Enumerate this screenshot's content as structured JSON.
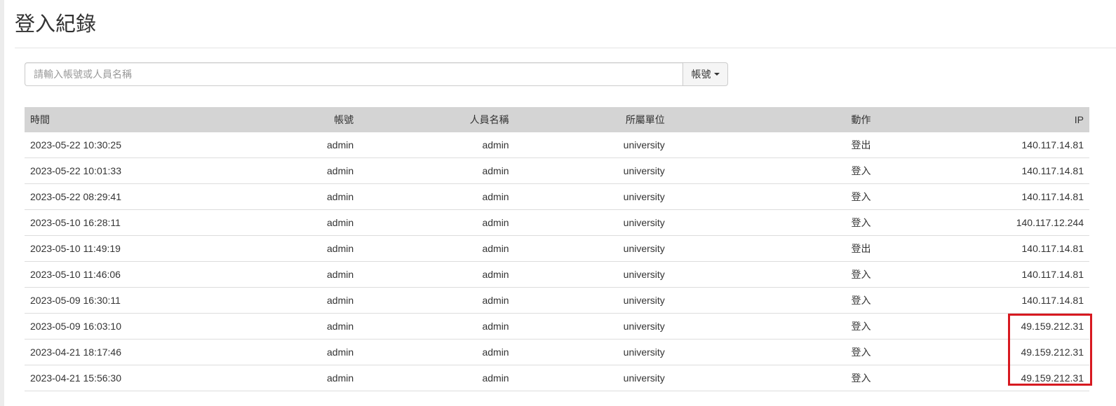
{
  "page": {
    "title": "登入紀錄"
  },
  "search": {
    "placeholder": "請輸入帳號或人員名稱",
    "field_selected": "帳號"
  },
  "table": {
    "headers": {
      "time": "時間",
      "account": "帳號",
      "name": "人員名稱",
      "unit": "所屬單位",
      "action": "動作",
      "ip": "IP"
    },
    "rows": [
      {
        "time": "2023-05-22 10:30:25",
        "account": "admin",
        "name": "admin",
        "unit": "university",
        "action": "登出",
        "ip": "140.117.14.81"
      },
      {
        "time": "2023-05-22 10:01:33",
        "account": "admin",
        "name": "admin",
        "unit": "university",
        "action": "登入",
        "ip": "140.117.14.81"
      },
      {
        "time": "2023-05-22 08:29:41",
        "account": "admin",
        "name": "admin",
        "unit": "university",
        "action": "登入",
        "ip": "140.117.14.81"
      },
      {
        "time": "2023-05-10 16:28:11",
        "account": "admin",
        "name": "admin",
        "unit": "university",
        "action": "登入",
        "ip": "140.117.12.244"
      },
      {
        "time": "2023-05-10 11:49:19",
        "account": "admin",
        "name": "admin",
        "unit": "university",
        "action": "登出",
        "ip": "140.117.14.81"
      },
      {
        "time": "2023-05-10 11:46:06",
        "account": "admin",
        "name": "admin",
        "unit": "university",
        "action": "登入",
        "ip": "140.117.14.81"
      },
      {
        "time": "2023-05-09 16:30:11",
        "account": "admin",
        "name": "admin",
        "unit": "university",
        "action": "登入",
        "ip": "140.117.14.81"
      },
      {
        "time": "2023-05-09 16:03:10",
        "account": "admin",
        "name": "admin",
        "unit": "university",
        "action": "登入",
        "ip": "49.159.212.31"
      },
      {
        "time": "2023-04-21 18:17:46",
        "account": "admin",
        "name": "admin",
        "unit": "university",
        "action": "登入",
        "ip": "49.159.212.31"
      },
      {
        "time": "2023-04-21 15:56:30",
        "account": "admin",
        "name": "admin",
        "unit": "university",
        "action": "登入",
        "ip": "49.159.212.31"
      }
    ]
  },
  "annotation": {
    "highlight_color": "#d71920"
  }
}
